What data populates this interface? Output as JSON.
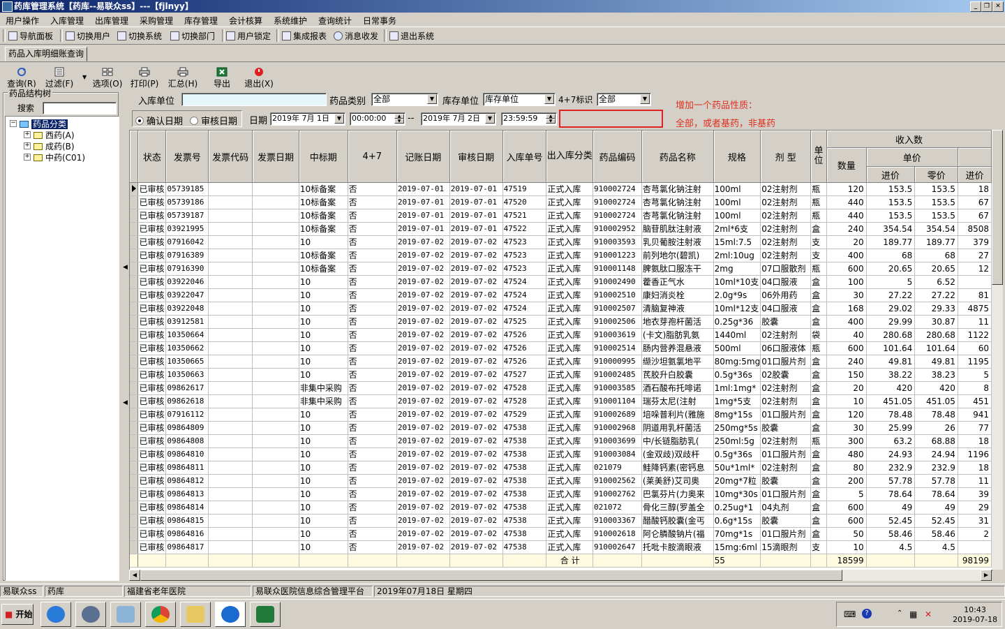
{
  "window": {
    "title": "药库管理系统【药库--易联众ss】---【fjlnyy】"
  },
  "menu": [
    "用户操作",
    "入库管理",
    "出库管理",
    "采购管理",
    "库存管理",
    "会计核算",
    "系统维护",
    "查询统计",
    "日常事务"
  ],
  "toolbar": [
    "导航面板",
    "切换用户",
    "切换系统",
    "切换部门",
    "用户锁定",
    "集成报表",
    "消息收发",
    "退出系统"
  ],
  "tab": {
    "label": "药品入库明细账查询"
  },
  "commands": [
    "查询(R)",
    "过滤(F)",
    "选项(O)",
    "打印(P)",
    "汇总(H)",
    "导出",
    "退出(X)"
  ],
  "left_panel": {
    "title": "药品结构树",
    "search_label": "搜索",
    "tree": {
      "root": "药品分类",
      "children": [
        "西药(A)",
        "成药(B)",
        "中药(C01)"
      ]
    }
  },
  "filters": {
    "warehouse_label": "入库单位",
    "category_label": "药品类别",
    "category_value": "全部",
    "stock_unit_label": "库存单位",
    "stock_unit_value": "库存单位",
    "flag_label": "4+7标识",
    "flag_value": "全部",
    "radio_confirm": "确认日期",
    "radio_audit": "审核日期",
    "date_label": "日期",
    "date_from": "2019年 7月 1日",
    "time_from": "00:00:00",
    "range_sep": "--",
    "date_to": "2019年 7月 2日",
    "time_to": "23:59:59",
    "note_line1": "增加一个药品性质：",
    "note_line2": "全部，或者基药，非基药"
  },
  "grid": {
    "group_header": "收入数",
    "unit_price_header": "单价",
    "columns": [
      "状态",
      "发票号",
      "发票代码",
      "发票日期",
      "中标期",
      "4+7",
      "记账日期",
      "审核日期",
      "入库单号",
      "出入库分类",
      "药品编码",
      "药品名称",
      "规格",
      "剂 型",
      "单位",
      "数量",
      "进价",
      "零价",
      "进价"
    ],
    "rows": [
      [
        "已审核",
        "05739185",
        "",
        "",
        "10标备案",
        "否",
        "2019-07-01",
        "2019-07-01",
        "47519",
        "正式入库",
        "910002724",
        "杏芎氯化钠注射",
        "100ml",
        "02注射剂",
        "瓶",
        "120",
        "153.5",
        "153.5",
        "18"
      ],
      [
        "已审核",
        "05739186",
        "",
        "",
        "10标备案",
        "否",
        "2019-07-01",
        "2019-07-01",
        "47520",
        "正式入库",
        "910002724",
        "杏芎氯化钠注射",
        "100ml",
        "02注射剂",
        "瓶",
        "440",
        "153.5",
        "153.5",
        "67"
      ],
      [
        "已审核",
        "05739187",
        "",
        "",
        "10标备案",
        "否",
        "2019-07-01",
        "2019-07-01",
        "47521",
        "正式入库",
        "910002724",
        "杏芎氯化钠注射",
        "100ml",
        "02注射剂",
        "瓶",
        "440",
        "153.5",
        "153.5",
        "67"
      ],
      [
        "已审核",
        "03921995",
        "",
        "",
        "10标备案",
        "否",
        "2019-07-01",
        "2019-07-01",
        "47522",
        "正式入库",
        "910002952",
        "脑苷肌肽注射液",
        "2ml*6支",
        "02注射剂",
        "盒",
        "240",
        "354.54",
        "354.54",
        "8508"
      ],
      [
        "已审核",
        "07916042",
        "",
        "",
        "10",
        "否",
        "2019-07-02",
        "2019-07-02",
        "47523",
        "正式入库",
        "910003593",
        "乳贝葡胺注射液",
        "15ml:7.5",
        "02注射剂",
        "支",
        "20",
        "189.77",
        "189.77",
        "379"
      ],
      [
        "已审核",
        "07916389",
        "",
        "",
        "10标备案",
        "否",
        "2019-07-02",
        "2019-07-02",
        "47523",
        "正式入库",
        "910001223",
        "前列地尔(碧凯)",
        "2ml:10ug",
        "02注射剂",
        "支",
        "400",
        "68",
        "68",
        "27"
      ],
      [
        "已审核",
        "07916390",
        "",
        "",
        "10标备案",
        "否",
        "2019-07-02",
        "2019-07-02",
        "47523",
        "正式入库",
        "910001148",
        "脾氨肽口服冻干",
        "2mg",
        "07口服散剂",
        "瓶",
        "600",
        "20.65",
        "20.65",
        "12"
      ],
      [
        "已审核",
        "03922046",
        "",
        "",
        "10",
        "否",
        "2019-07-02",
        "2019-07-02",
        "47524",
        "正式入库",
        "910002490",
        "藿香正气水",
        "10ml*10支",
        "04口服液",
        "盒",
        "100",
        "5",
        "6.52",
        ""
      ],
      [
        "已审核",
        "03922047",
        "",
        "",
        "10",
        "否",
        "2019-07-02",
        "2019-07-02",
        "47524",
        "正式入库",
        "910002510",
        "康妇消炎栓",
        "2.0g*9s",
        "06外用药",
        "盒",
        "30",
        "27.22",
        "27.22",
        "81"
      ],
      [
        "已审核",
        "03922048",
        "",
        "",
        "10",
        "否",
        "2019-07-02",
        "2019-07-02",
        "47524",
        "正式入库",
        "910002507",
        "清脑复神液",
        "10ml*12支",
        "04口服液",
        "盒",
        "168",
        "29.02",
        "29.33",
        "4875"
      ],
      [
        "已审核",
        "03912581",
        "",
        "",
        "10",
        "否",
        "2019-07-02",
        "2019-07-02",
        "47525",
        "正式入库",
        "910002506",
        "地衣芽孢杆菌活",
        "0.25g*36",
        "胶囊",
        "盒",
        "400",
        "29.99",
        "30.87",
        "11"
      ],
      [
        "已审核",
        "10350664",
        "",
        "",
        "10",
        "否",
        "2019-07-02",
        "2019-07-02",
        "47526",
        "正式入库",
        "910003619",
        "(卡文)脂肪乳氨",
        "1440ml",
        "02注射剂",
        "袋",
        "40",
        "280.68",
        "280.68",
        "1122"
      ],
      [
        "已审核",
        "10350662",
        "",
        "",
        "10",
        "否",
        "2019-07-02",
        "2019-07-02",
        "47526",
        "正式入库",
        "910002514",
        "肠内营养混悬液",
        "500ml",
        "06口服液体",
        "瓶",
        "600",
        "101.64",
        "101.64",
        "60"
      ],
      [
        "已审核",
        "10350665",
        "",
        "",
        "10",
        "否",
        "2019-07-02",
        "2019-07-02",
        "47526",
        "正式入库",
        "910000995",
        "缬沙坦氨氯地平",
        "80mg:5mg",
        "01口服片剂",
        "盒",
        "240",
        "49.81",
        "49.81",
        "1195"
      ],
      [
        "已审核",
        "10350663",
        "",
        "",
        "10",
        "否",
        "2019-07-02",
        "2019-07-02",
        "47527",
        "正式入库",
        "910002485",
        "芪胶升白胶囊",
        "0.5g*36s",
        "02胶囊",
        "盒",
        "150",
        "38.22",
        "38.23",
        "5"
      ],
      [
        "已审核",
        "09862617",
        "",
        "",
        "非集中采购",
        "否",
        "2019-07-02",
        "2019-07-02",
        "47528",
        "正式入库",
        "910003585",
        "酒石酸布托啡诺",
        "1ml:1mg*",
        "02注射剂",
        "盒",
        "20",
        "420",
        "420",
        "8"
      ],
      [
        "已审核",
        "09862618",
        "",
        "",
        "非集中采购",
        "否",
        "2019-07-02",
        "2019-07-02",
        "47528",
        "正式入库",
        "910001104",
        "瑞芬太尼(注射",
        "1mg*5支",
        "02注射剂",
        "盒",
        "10",
        "451.05",
        "451.05",
        "451"
      ],
      [
        "已审核",
        "07916112",
        "",
        "",
        "10",
        "否",
        "2019-07-02",
        "2019-07-02",
        "47529",
        "正式入库",
        "910002689",
        "培哚普利片(雅施",
        "8mg*15s",
        "01口服片剂",
        "盒",
        "120",
        "78.48",
        "78.48",
        "941"
      ],
      [
        "已审核",
        "09864809",
        "",
        "",
        "10",
        "否",
        "2019-07-02",
        "2019-07-02",
        "47538",
        "正式入库",
        "910002968",
        "阴道用乳杆菌活",
        "250mg*5s",
        "胶囊",
        "盒",
        "30",
        "25.99",
        "26",
        "77"
      ],
      [
        "已审核",
        "09864808",
        "",
        "",
        "10",
        "否",
        "2019-07-02",
        "2019-07-02",
        "47538",
        "正式入库",
        "910003699",
        "中/长链脂肪乳(",
        "250ml:5g",
        "02注射剂",
        "瓶",
        "300",
        "63.2",
        "68.88",
        "18"
      ],
      [
        "已审核",
        "09864810",
        "",
        "",
        "10",
        "否",
        "2019-07-02",
        "2019-07-02",
        "47538",
        "正式入库",
        "910003084",
        "(金双歧)双歧杆",
        "0.5g*36s",
        "01口服片剂",
        "盒",
        "480",
        "24.93",
        "24.94",
        "1196"
      ],
      [
        "已审核",
        "09864811",
        "",
        "",
        "10",
        "否",
        "2019-07-02",
        "2019-07-02",
        "47538",
        "正式入库",
        "021079",
        "鲑降钙素(密钙息",
        "50u*1ml*",
        "02注射剂",
        "盒",
        "80",
        "232.9",
        "232.9",
        "18"
      ],
      [
        "已审核",
        "09864812",
        "",
        "",
        "10",
        "否",
        "2019-07-02",
        "2019-07-02",
        "47538",
        "正式入库",
        "910002562",
        "(莱美舒)艾司奥",
        "20mg*7粒",
        "胶囊",
        "盒",
        "200",
        "57.78",
        "57.78",
        "11"
      ],
      [
        "已审核",
        "09864813",
        "",
        "",
        "10",
        "否",
        "2019-07-02",
        "2019-07-02",
        "47538",
        "正式入库",
        "910002762",
        "巴氯芬片(力奥来",
        "10mg*30s",
        "01口服片剂",
        "盒",
        "5",
        "78.64",
        "78.64",
        "39"
      ],
      [
        "已审核",
        "09864814",
        "",
        "",
        "10",
        "否",
        "2019-07-02",
        "2019-07-02",
        "47538",
        "正式入库",
        "021072",
        "骨化三醇(罗盖全",
        "0.25ug*1",
        "04丸剂",
        "盒",
        "600",
        "49",
        "49",
        "29"
      ],
      [
        "已审核",
        "09864815",
        "",
        "",
        "10",
        "否",
        "2019-07-02",
        "2019-07-02",
        "47538",
        "正式入库",
        "910003367",
        "醋酸钙胶囊(金丐",
        "0.6g*15s",
        "胶囊",
        "盒",
        "600",
        "52.45",
        "52.45",
        "31"
      ],
      [
        "已审核",
        "09864816",
        "",
        "",
        "10",
        "否",
        "2019-07-02",
        "2019-07-02",
        "47538",
        "正式入库",
        "910002618",
        "阿仑膦酸钠片(福",
        "70mg*1s",
        "01口服片剂",
        "盒",
        "50",
        "58.46",
        "58.46",
        "2"
      ],
      [
        "已审核",
        "09864817",
        "",
        "",
        "10",
        "否",
        "2019-07-02",
        "2019-07-02",
        "47538",
        "正式入库",
        "910002647",
        "托吡卡胺滴眼液",
        "15mg:6ml",
        "15滴眼剂",
        "支",
        "10",
        "4.5",
        "4.5",
        ""
      ]
    ],
    "total_label": "合 计",
    "total_count": "55",
    "total_qty": "18599",
    "total_amount": "98199"
  },
  "statusbar": [
    "易联众ss",
    "药库",
    "福建省老年医院",
    "易联众医院信息综合管理平台",
    "2019年07月18日 星期四"
  ],
  "taskbar": {
    "start": "开始",
    "time": "10:43",
    "date": "2019-07-18"
  }
}
